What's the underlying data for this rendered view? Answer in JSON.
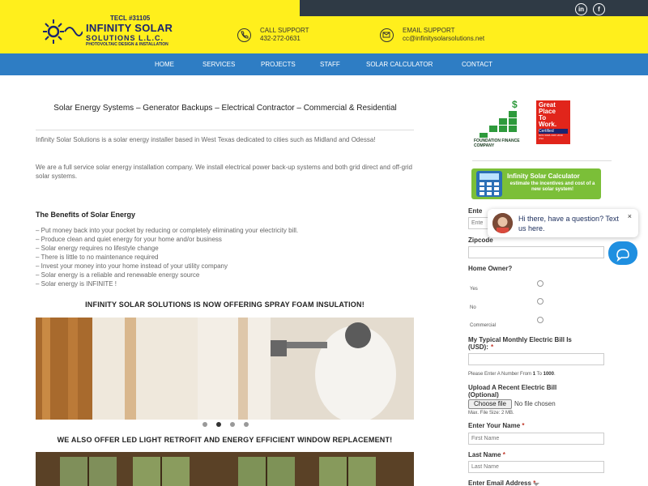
{
  "header": {
    "license": "TECL #31105",
    "company_line1": "INFINITY SOLAR",
    "company_line2": "SOLUTIONS L.L.C.",
    "tagline": "PHOTOVOLTAIC DESIGN & INSTALLATION",
    "call_label": "CALL SUPPORT",
    "call_value": "432-272-0631",
    "email_label": "EMAIL SUPPORT",
    "email_value": "cc@infinitysolarsolutions.net",
    "social": [
      "in",
      "f"
    ]
  },
  "nav": {
    "items": [
      "HOME",
      "SERVICES",
      "PROJECTS",
      "STAFF",
      "SOLAR CALCULATOR",
      "CONTACT"
    ]
  },
  "main": {
    "title": "Solar Energy Systems – Generator Backups – Electrical Contractor – Commercial & Residential",
    "intro": "Infinity Solar Solutions is a solar energy installer based in West Texas dedicated to cities such as Midland and Odessa!",
    "intro2": "We are a full service solar energy installation company. We install electrical power back-up systems and both grid direct and off-grid solar systems.",
    "benefits_heading": "The Benefits of Solar Energy",
    "benefits": [
      "– Put money back into your pocket by reducing or completely eliminating your electricity bill.",
      "– Produce clean and quiet energy for your home and/or business",
      "– Solar energy requires no lifestyle change",
      "– There is little to no maintenance required",
      "– Invest your money into your home instead of your utility company",
      "– Solar energy is a reliable and renewable energy source",
      "– Solar energy is INFINITE !"
    ],
    "spray_heading": "INFINITY SOLAR SOLUTIONS IS NOW OFFERING SPRAY FOAM INSULATION!",
    "led_heading": "WE ALSO OFFER LED LIGHT RETROFIT AND ENERGY EFFICIENT WINDOW REPLACEMENT!",
    "slider_count": 4,
    "slider_active": 2
  },
  "sidebar": {
    "badge1": "FOUNDATION FINANCE COMPANY",
    "badge2_lines": [
      "Great",
      "Place",
      "To",
      "Work.",
      "Certified",
      "NOV 2018–NOV 2019",
      "USA"
    ],
    "calc_title": "Infinity Solar Calculator",
    "calc_sub": "estimate the incentives and cost of a new solar system!",
    "form": {
      "enter_label": "Ente",
      "enter_placeholder": "Ente",
      "zipcode_label": "Zipcode",
      "owner_label": "Home Owner?",
      "owner_options": [
        "Yes",
        "No",
        "Commercial"
      ],
      "bill_label_1": "My Typical Monthly Electric Bill Is",
      "bill_label_2": "(USD):",
      "bill_hint_pre": "Please Enter A Number From ",
      "bill_hint_min": "1",
      "bill_hint_mid": " To ",
      "bill_hint_max": "1000",
      "bill_hint_end": ".",
      "upload_label_1": "Upload A Recent Electric Bill",
      "upload_label_2": "(Optional)",
      "choose_file": "Choose file",
      "no_file": "No file chosen",
      "max_size": "Max. File Size: 2 MB.",
      "first_label": "Enter Your Name",
      "first_placeholder": "First Name",
      "last_label": "Last Name",
      "last_placeholder": "Last Name",
      "email_label": "Enter Email Address",
      "req": "*"
    }
  },
  "chat": {
    "message": "Hi there, have a question? Text us here.",
    "close": "×"
  },
  "colors": {
    "header_yellow": "#ffef1c",
    "nav_blue": "#2e7dc4",
    "navy": "#1a2470",
    "calc_green": "#7bbf38",
    "chat_blue": "#1f8fe0"
  }
}
